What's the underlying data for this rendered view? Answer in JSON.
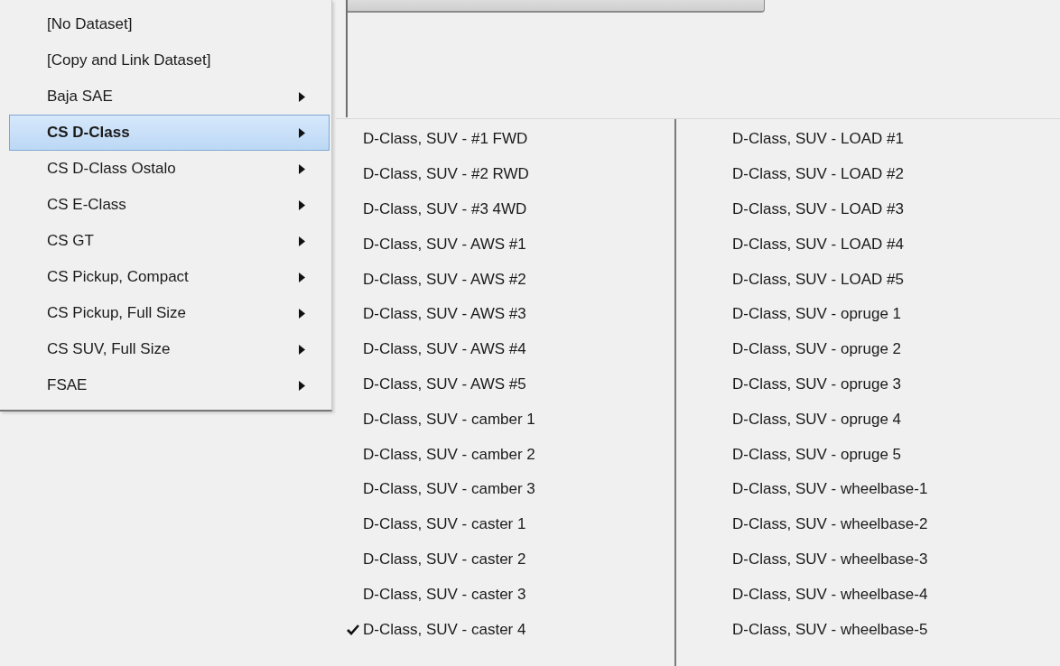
{
  "menu": {
    "items": [
      {
        "label": "[No Dataset]",
        "has_submenu": false,
        "selected": false
      },
      {
        "label": "[Copy and Link Dataset]",
        "has_submenu": false,
        "selected": false
      },
      {
        "label": "Baja SAE",
        "has_submenu": true,
        "selected": false
      },
      {
        "label": "CS D-Class",
        "has_submenu": true,
        "selected": true
      },
      {
        "label": "CS D-Class Ostalo",
        "has_submenu": true,
        "selected": false
      },
      {
        "label": "CS E-Class",
        "has_submenu": true,
        "selected": false
      },
      {
        "label": "CS GT",
        "has_submenu": true,
        "selected": false
      },
      {
        "label": "CS Pickup, Compact",
        "has_submenu": true,
        "selected": false
      },
      {
        "label": "CS Pickup, Full Size",
        "has_submenu": true,
        "selected": false
      },
      {
        "label": "CS SUV, Full Size",
        "has_submenu": true,
        "selected": false
      },
      {
        "label": "FSAE",
        "has_submenu": true,
        "selected": false
      }
    ]
  },
  "submenu": {
    "columns": [
      {
        "items": [
          {
            "label": "D-Class, SUV - #1 FWD",
            "checked": false
          },
          {
            "label": "D-Class, SUV - #2 RWD",
            "checked": false
          },
          {
            "label": "D-Class, SUV - #3 4WD",
            "checked": false
          },
          {
            "label": "D-Class, SUV - AWS #1",
            "checked": false
          },
          {
            "label": "D-Class, SUV - AWS #2",
            "checked": false
          },
          {
            "label": "D-Class, SUV - AWS #3",
            "checked": false
          },
          {
            "label": "D-Class, SUV - AWS #4",
            "checked": false
          },
          {
            "label": "D-Class, SUV - AWS #5",
            "checked": false
          },
          {
            "label": "D-Class, SUV - camber 1",
            "checked": false
          },
          {
            "label": "D-Class, SUV - camber 2",
            "checked": false
          },
          {
            "label": "D-Class, SUV - camber 3",
            "checked": false
          },
          {
            "label": "D-Class, SUV - caster 1",
            "checked": false
          },
          {
            "label": "D-Class, SUV - caster 2",
            "checked": false
          },
          {
            "label": "D-Class, SUV - caster 3",
            "checked": false
          },
          {
            "label": "D-Class, SUV - caster 4",
            "checked": true
          }
        ]
      },
      {
        "items": [
          {
            "label": "D-Class, SUV - LOAD #1",
            "checked": false
          },
          {
            "label": "D-Class, SUV - LOAD #2",
            "checked": false
          },
          {
            "label": "D-Class, SUV - LOAD #3",
            "checked": false
          },
          {
            "label": "D-Class, SUV - LOAD #4",
            "checked": false
          },
          {
            "label": "D-Class, SUV - LOAD #5",
            "checked": false
          },
          {
            "label": "D-Class, SUV - opruge 1",
            "checked": false
          },
          {
            "label": "D-Class, SUV - opruge 2",
            "checked": false
          },
          {
            "label": "D-Class, SUV - opruge 3",
            "checked": false
          },
          {
            "label": "D-Class, SUV - opruge 4",
            "checked": false
          },
          {
            "label": "D-Class, SUV - opruge 5",
            "checked": false
          },
          {
            "label": "D-Class, SUV - wheelbase-1",
            "checked": false
          },
          {
            "label": "D-Class, SUV - wheelbase-2",
            "checked": false
          },
          {
            "label": "D-Class, SUV - wheelbase-3",
            "checked": false
          },
          {
            "label": "D-Class, SUV - wheelbase-4",
            "checked": false
          },
          {
            "label": "D-Class, SUV - wheelbase-5",
            "checked": false
          }
        ]
      }
    ]
  }
}
